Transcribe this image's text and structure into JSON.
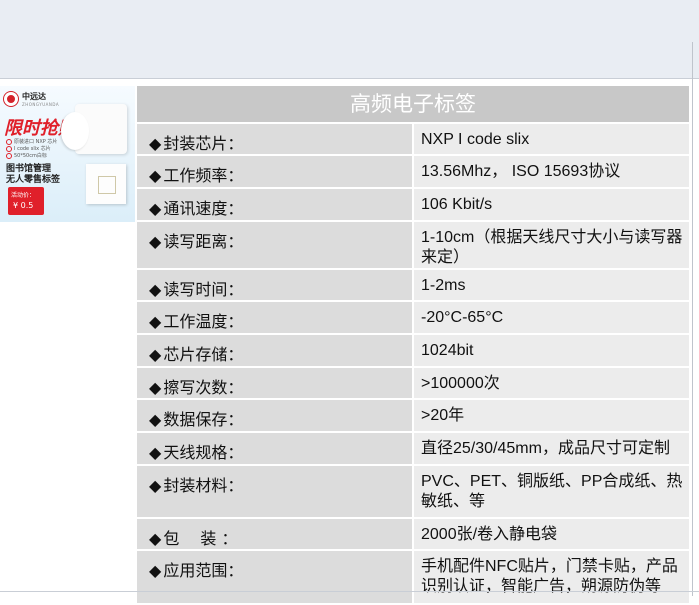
{
  "banner": {
    "brand": "中远达",
    "brand_sub": "ZHONGYUANDA",
    "promo": "限时抢购",
    "features": [
      "原装进口 NXP 芯片",
      "I code slix 芯片",
      "50*50cm白标"
    ],
    "headline_1": "图书馆管理",
    "headline_2": "无人零售标签",
    "price_label": "活动价：",
    "price_value": "¥ 0.5"
  },
  "table": {
    "title": "高频电子标签",
    "bullet": "◆",
    "rows": [
      {
        "label": "封装芯片：",
        "value": "NXP I code slix"
      },
      {
        "label": "工作频率：",
        "value": "13.56Mhz， ISO 15693协议"
      },
      {
        "label": "通讯速度：",
        "value": "106 Kbit/s"
      },
      {
        "label": "读写距离：",
        "value": "1-10cm（根据天线尺寸大小与读写器来定）"
      },
      {
        "label": "读写时间：",
        "value": "1-2ms"
      },
      {
        "label": "工作温度：",
        "value": "-20°C-65°C"
      },
      {
        "label": "芯片存储：",
        "value": "1024bit"
      },
      {
        "label": "擦写次数：",
        "value": ">100000次"
      },
      {
        "label": "数据保存：",
        "value": ">20年"
      },
      {
        "label": "天线规格：",
        "value": "直径25/30/45mm，成品尺寸可定制"
      },
      {
        "label": "封装材料：",
        "value": "PVC、PET、铜版纸、PP合成纸、热敏纸、等"
      },
      {
        "label": "包　 装 ：",
        "value": "2000张/卷入静电袋"
      },
      {
        "label": "应用范围：",
        "value": "手机配件NFC贴片，门禁卡贴，产品识别认证，智能广告，朔源防伪等"
      }
    ]
  },
  "colors": {
    "title_bg": "#c8c8c8",
    "label_bg": "#dcdcdc",
    "value_bg": "#ececec",
    "accent_red": "#e0202a"
  }
}
